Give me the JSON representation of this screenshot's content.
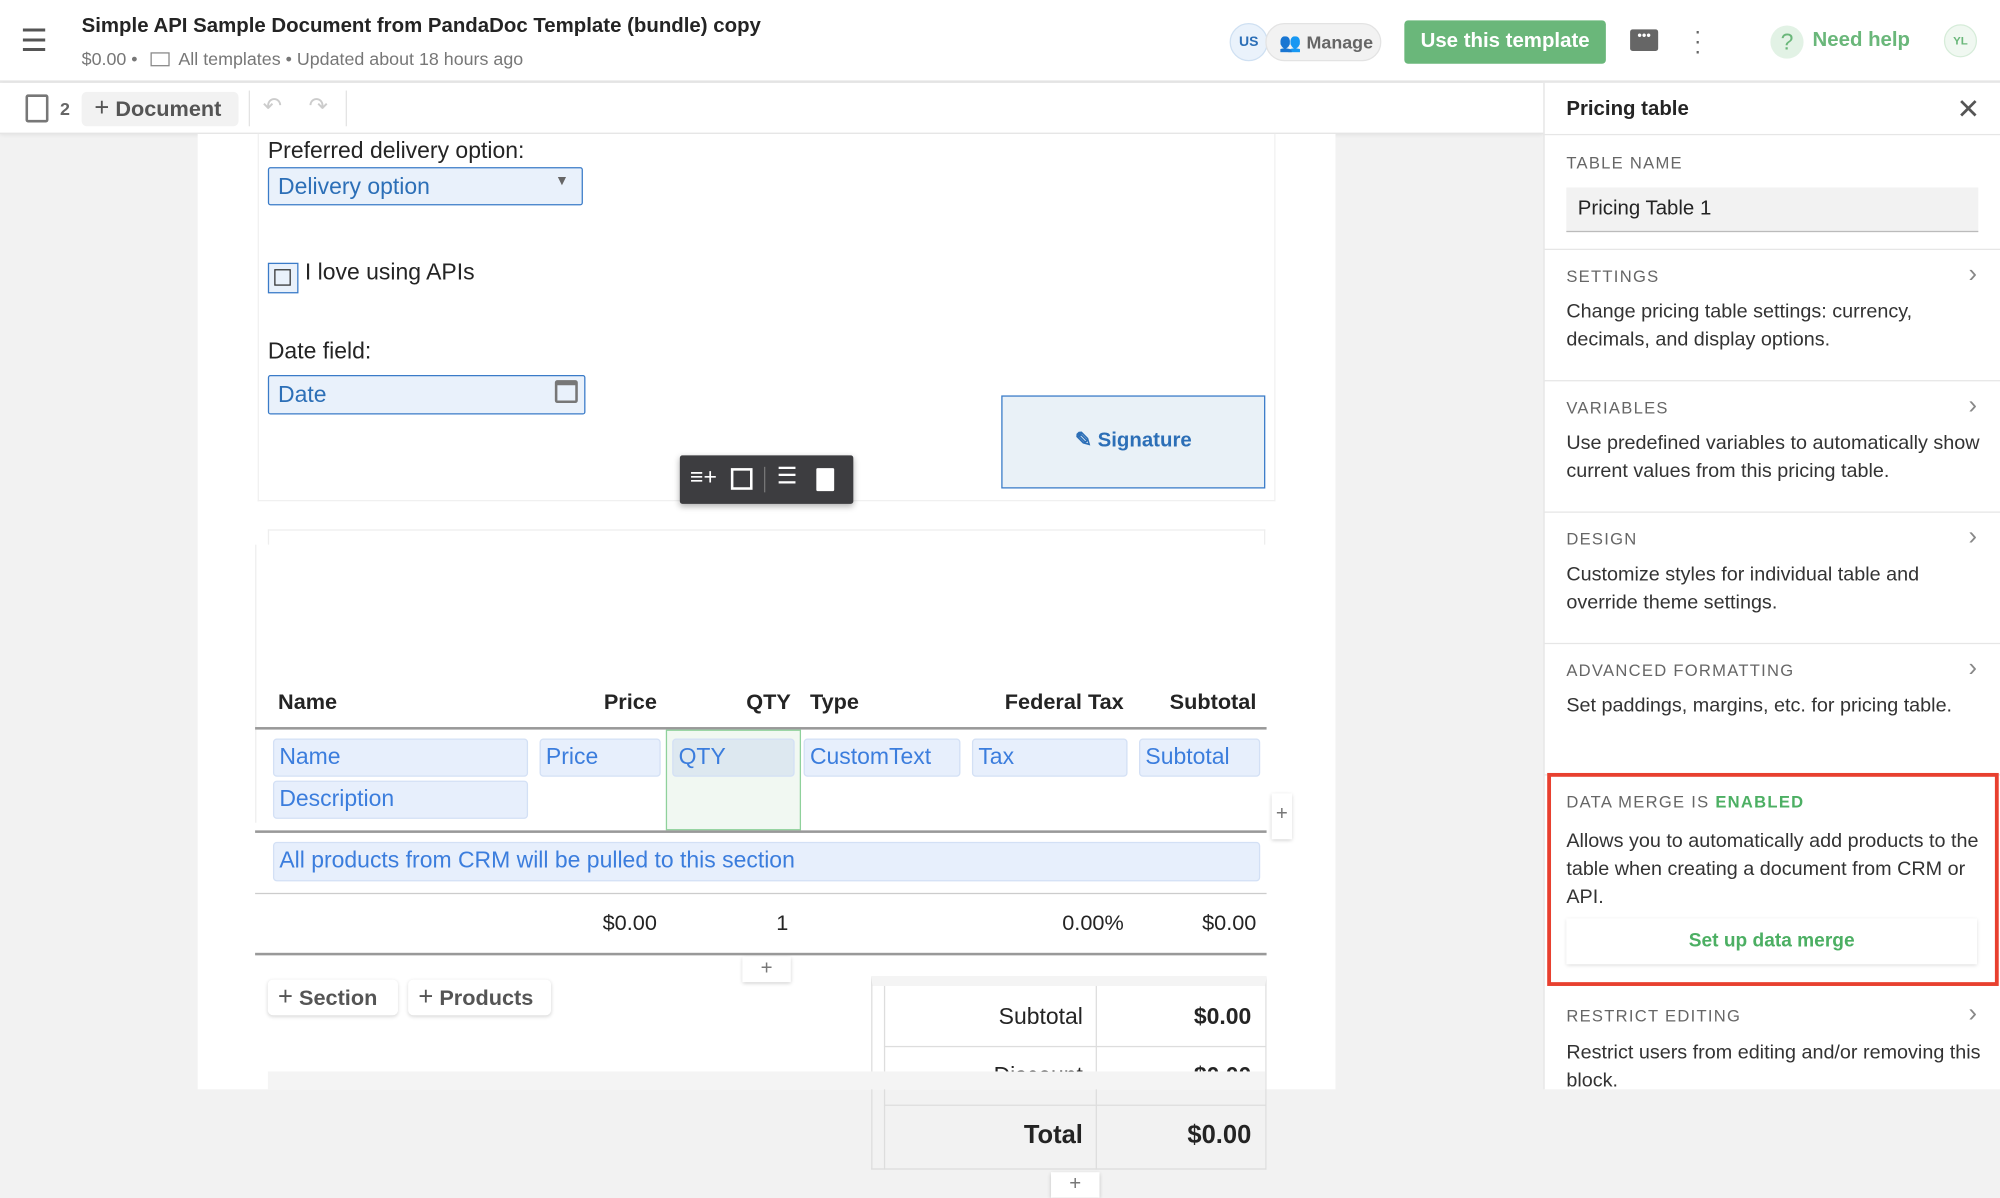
{
  "header": {
    "title": "Simple API Sample Document from PandaDoc Template (bundle) copy",
    "amount": "$0.00",
    "folder": "All templates",
    "updated": "Updated about 18 hours ago",
    "user_initials": "US",
    "manage": "Manage",
    "use_template": "Use this template",
    "need_help": "Need help",
    "avatar": "YL",
    "accent": "#6ab77a"
  },
  "toolbar": {
    "page_count": "2",
    "add_document": "Document"
  },
  "document": {
    "delivery_label": "Preferred delivery option:",
    "delivery_value": "Delivery option",
    "checkbox_label": "I love using APIs",
    "date_label": "Date field:",
    "date_placeholder": "Date",
    "signature": "Signature",
    "table": {
      "headers": [
        "Name",
        "Price",
        "QTY",
        "Type",
        "Federal Tax",
        "Subtotal"
      ],
      "fields": [
        "Name",
        "Price",
        "QTY",
        "CustomText",
        "Tax",
        "Subtotal"
      ],
      "description": "Description",
      "crm_note": "All products from CRM will be pulled to this section",
      "row": {
        "price": "$0.00",
        "qty": "1",
        "tax": "0.00%",
        "subtotal": "$0.00"
      },
      "add_section": "Section",
      "add_products": "Products",
      "totals": [
        {
          "label": "Subtotal",
          "value": "$0.00"
        },
        {
          "label": "Discount",
          "value": "$0.00"
        },
        {
          "label": "Total",
          "value": "$0.00"
        }
      ]
    }
  },
  "panel": {
    "title": "Pricing table",
    "table_name_label": "TABLE NAME",
    "table_name_value": "Pricing Table 1",
    "sections": [
      {
        "title": "SETTINGS",
        "text": "Change pricing table settings: currency, decimals, and display options."
      },
      {
        "title": "VARIABLES",
        "text": "Use predefined variables to automatically show current values from this pricing table."
      },
      {
        "title": "DESIGN",
        "text": "Customize styles for individual table and override theme settings."
      },
      {
        "title": "ADVANCED FORMATTING",
        "text": "Set paddings, margins, etc. for pricing table."
      }
    ],
    "data_merge": {
      "title": "DATA MERGE IS",
      "status": "ENABLED",
      "text": "Allows you to automatically add products to the table when creating a document from CRM or API.",
      "button": "Set up data merge",
      "highlight": "#e8402f"
    },
    "restrict": {
      "title": "RESTRICT EDITING",
      "text": "Restrict users from editing and/or removing this block."
    }
  }
}
